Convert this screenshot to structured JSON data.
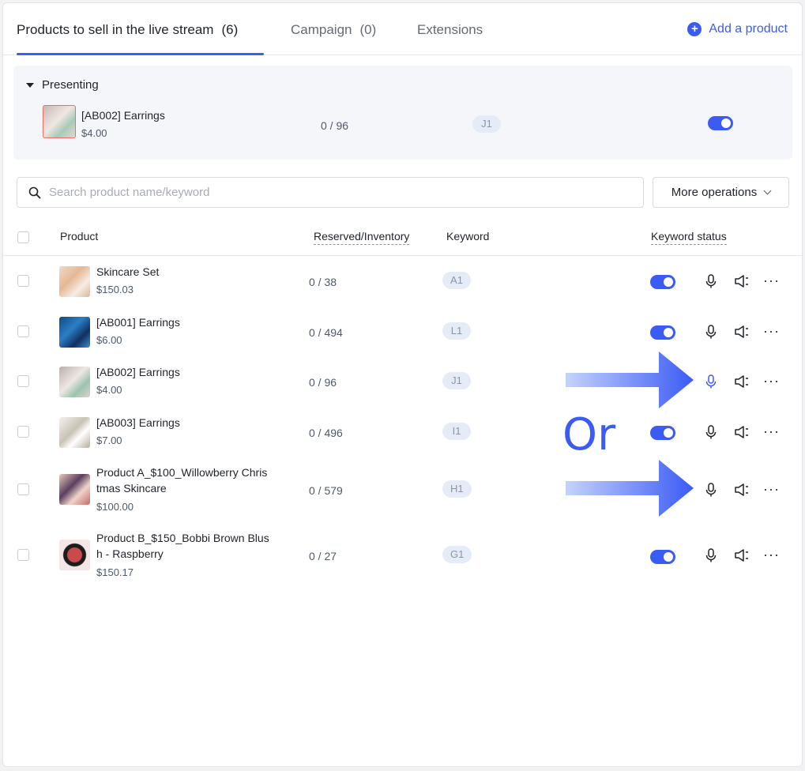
{
  "tabs": [
    {
      "label": "Products to sell in the live stream",
      "count": "(6)"
    },
    {
      "label": "Campaign",
      "count": "(0)"
    },
    {
      "label": "Extensions",
      "count": ""
    }
  ],
  "add_product_label": "Add a product",
  "presenting": {
    "label": "Presenting",
    "product": {
      "name": "[AB002] Earrings",
      "price": "$4.00",
      "inventory": "0 / 96",
      "keyword": "J1",
      "keyword_enabled": true
    }
  },
  "search": {
    "placeholder": "Search product name/keyword",
    "value": ""
  },
  "more_operations_label": "More operations",
  "table_headers": {
    "product": "Product",
    "inventory": "Reserved/Inventory",
    "keyword": "Keyword",
    "keyword_status": "Keyword status"
  },
  "products": [
    {
      "name": "Skincare Set",
      "price": "$150.03",
      "inventory": "0 / 38",
      "keyword": "A1",
      "keyword_enabled": true
    },
    {
      "name": "[AB001] Earrings",
      "price": "$6.00",
      "inventory": "0 / 494",
      "keyword": "L1",
      "keyword_enabled": true
    },
    {
      "name": "[AB002] Earrings",
      "price": "$4.00",
      "inventory": "0 / 96",
      "keyword": "J1",
      "keyword_enabled": false
    },
    {
      "name": "[AB003] Earrings",
      "price": "$7.00",
      "inventory": "0 / 496",
      "keyword": "I1",
      "keyword_enabled": true
    },
    {
      "name": "Product A_$100_Willowberry Chris\ntmas Skincare",
      "price": "$100.00",
      "inventory": "0 / 579",
      "keyword": "H1",
      "keyword_enabled": false
    },
    {
      "name": "Product B_$150_Bobbi Brown Blus\nh - Raspberry",
      "price": "$150.17",
      "inventory": "0 / 27",
      "keyword": "G1",
      "keyword_enabled": true
    }
  ],
  "annotation": {
    "or_text": "Or"
  },
  "colors": {
    "accent": "#3b5bf5",
    "keyword_pill": "#e6ecf7"
  }
}
